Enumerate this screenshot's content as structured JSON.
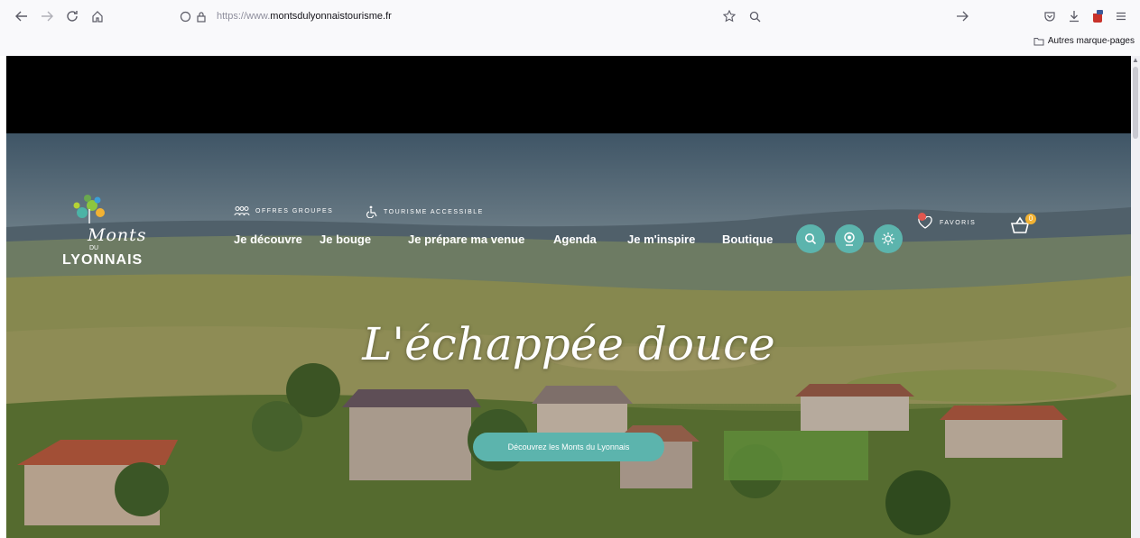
{
  "browser": {
    "url_prefix": "https://www.",
    "url_domain": "montsdulyonnaistourisme.fr",
    "bookmarks_folder": "Autres marque-pages"
  },
  "site": {
    "logo": {
      "script": "Monts",
      "du": "DU",
      "name": "LYONNAIS"
    },
    "top_links": [
      {
        "label": "OFFRES GROUPES",
        "icon": "group-icon"
      },
      {
        "label": "TOURISME ACCESSIBLE",
        "icon": "wheelchair-icon"
      }
    ],
    "menu": [
      "Je découvre",
      "Je bouge",
      "Je prépare ma venue",
      "Agenda",
      "Je m'inspire",
      "Boutique"
    ],
    "round_buttons": [
      "search-icon",
      "webcam-icon",
      "weather-sun-icon"
    ],
    "favorites": {
      "label": "FAVORIS",
      "count": "0"
    },
    "cart": {
      "count": "0"
    },
    "hero": {
      "headline": "L'échappée douce",
      "cta": "Découvrez les Monts du Lyonnais"
    }
  },
  "colors": {
    "teal": "#5cb4ad",
    "badge_red": "#e0574f",
    "badge_yellow": "#f2b233"
  }
}
